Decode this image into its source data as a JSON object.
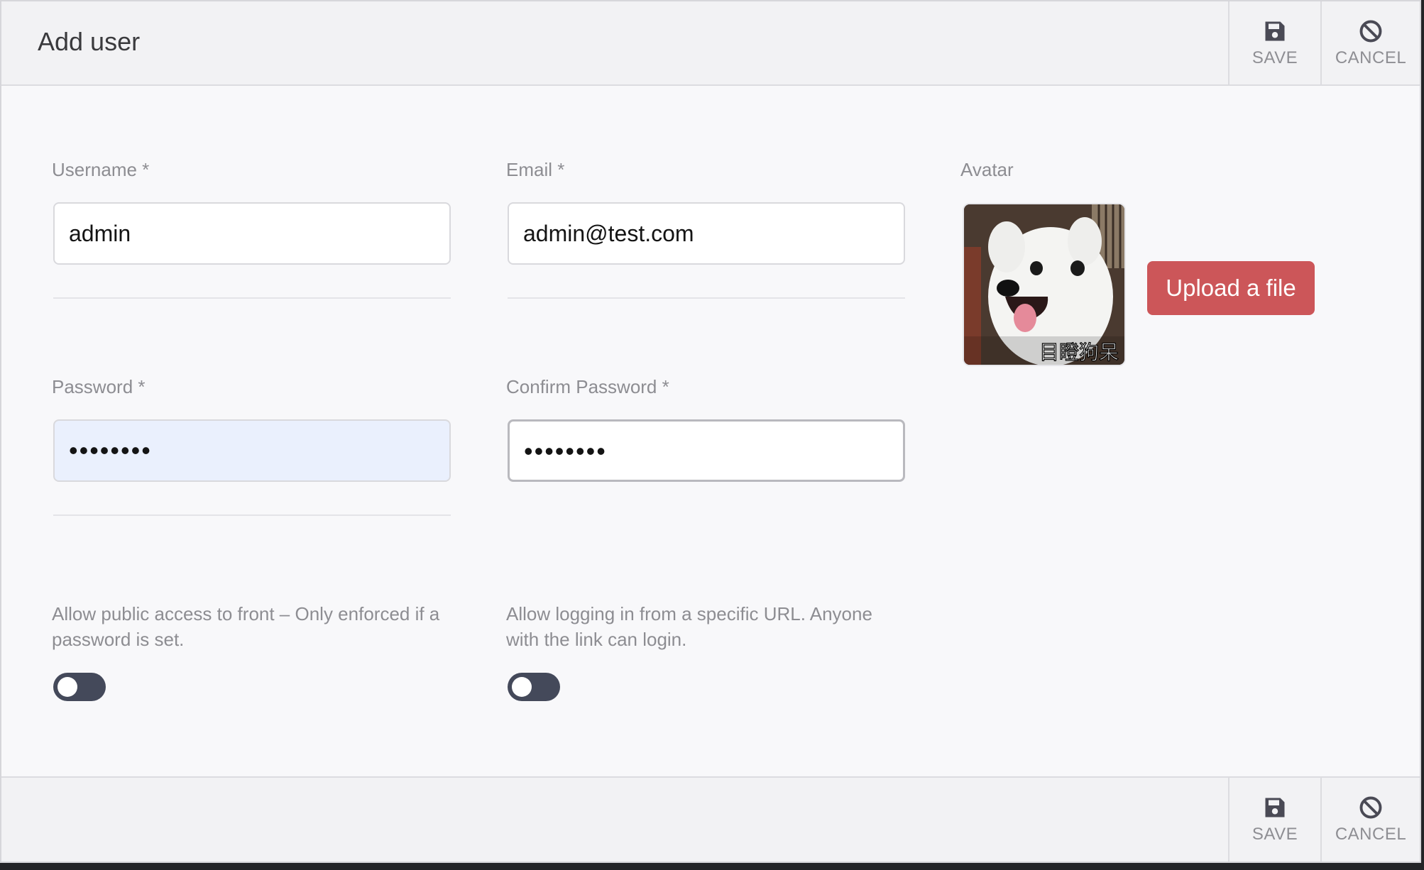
{
  "header": {
    "title": "Add user"
  },
  "actions": {
    "save_label": "SAVE",
    "cancel_label": "CANCEL"
  },
  "form": {
    "username": {
      "label": "Username *",
      "value": "admin"
    },
    "email": {
      "label": "Email *",
      "value": "admin@test.com"
    },
    "password": {
      "label": "Password *",
      "value": "••••••••"
    },
    "confirm_password": {
      "label": "Confirm Password *",
      "value": "••••••••"
    },
    "avatar": {
      "label": "Avatar",
      "upload_label": "Upload a file",
      "image_caption": "目瞪狗呆"
    },
    "public_access": {
      "description": "Allow public access to front – Only enforced if a password is set.",
      "enabled": false
    },
    "url_login": {
      "description": "Allow logging in from a specific URL. Anyone with the link can login.",
      "enabled": false
    }
  },
  "colors": {
    "upload_button": "#cc5659",
    "toggle_track": "#44495a",
    "autofill_bg": "#eaf0fd"
  },
  "icons": {
    "save": "floppy-disk-icon",
    "cancel": "prohibited-icon"
  }
}
